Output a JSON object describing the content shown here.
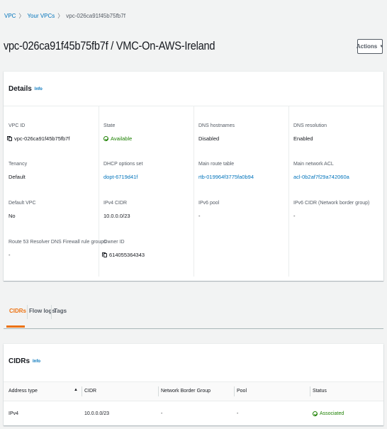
{
  "breadcrumb": {
    "items": [
      "VPC",
      "Your VPCs"
    ],
    "current": "vpc-026ca91f45b75fb7f",
    "separator": "〉"
  },
  "header": {
    "title": "vpc-026ca91f45b75fb7f / VMC-On-AWS-Ireland",
    "actions_label": "Actions",
    "actions_caret": "▼"
  },
  "details": {
    "title": "Details",
    "info": "Info",
    "fields": {
      "vpc_id": {
        "label": "VPC ID",
        "value": "vpc-026ca91f45b75fb7f"
      },
      "state": {
        "label": "State",
        "value": "Available"
      },
      "dns_hostnames": {
        "label": "DNS hostnames",
        "value": "Disabled"
      },
      "dns_resolution": {
        "label": "DNS resolution",
        "value": "Enabled"
      },
      "tenancy": {
        "label": "Tenancy",
        "value": "Default"
      },
      "dhcp": {
        "label": "DHCP options set",
        "value": "dopt-6719d41f"
      },
      "main_route_table": {
        "label": "Main route table",
        "value": "rtb-019964f3775fa0b94"
      },
      "main_network_acl": {
        "label": "Main network ACL",
        "value": "acl-0b2af7f29a742060a"
      },
      "default_vpc": {
        "label": "Default VPC",
        "value": "No"
      },
      "ipv4_cidr": {
        "label": "IPv4 CIDR",
        "value": "10.0.0.0/23"
      },
      "ipv6_pool": {
        "label": "IPv6 pool",
        "value": "-"
      },
      "ipv6_cidr": {
        "label": "IPv6 CIDR (Network border group)",
        "value": "-"
      },
      "route53": {
        "label": "Route 53 Resolver DNS Firewall rule groups",
        "value": "-"
      },
      "owner_id": {
        "label": "Owner ID",
        "value": "614055364343"
      }
    }
  },
  "tabs": [
    "CIDRs",
    "Flow logs",
    "Tags"
  ],
  "cidrs": {
    "title": "CIDRs",
    "info": "Info",
    "columns": [
      "Address type",
      "CIDR",
      "Network Border Group",
      "Pool",
      "Status"
    ],
    "sort_icon": "▲",
    "rows": [
      {
        "address_type": "IPv4",
        "cidr": "10.0.0.0/23",
        "network_border_group": "-",
        "pool": "-",
        "status": "Associated"
      }
    ]
  },
  "colors": {
    "link": "#0073bb",
    "success": "#1d8102",
    "active_tab": "#ec7211",
    "background": "#f2f3f3"
  }
}
